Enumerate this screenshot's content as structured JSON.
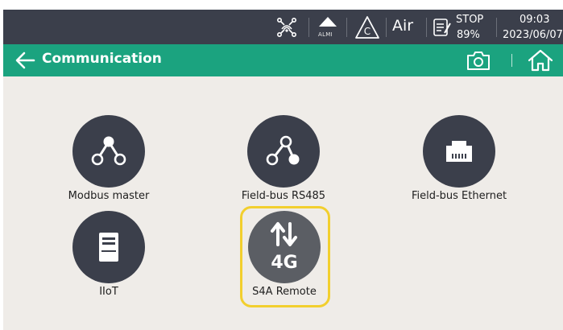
{
  "status_bar": {
    "almi_label": "ALMI",
    "air_label": "Air",
    "stop_label": "STOP",
    "percent": "89%",
    "time": "09:03",
    "date": "2023/06/07"
  },
  "title_bar": {
    "title": "Communication"
  },
  "tiles": [
    {
      "label": "Modbus master"
    },
    {
      "label": "Field-bus RS485"
    },
    {
      "label": "Field-bus Ethernet"
    },
    {
      "label": "IIoT"
    },
    {
      "label": "S4A Remote",
      "icon_text": "4G",
      "highlighted": true
    }
  ],
  "colors": {
    "status_bar_bg": "#3b3f4b",
    "title_bar_bg": "#1ba37f",
    "content_bg": "#efece8",
    "icon_circle": "#3b3f4b",
    "highlight": "#f2cf2e",
    "s4a_circle": "#5b5e64"
  },
  "icons": [
    "network-alert-icon",
    "alarm-triangle-icon",
    "c-warning-icon",
    "checklist-icon",
    "back-arrow-icon",
    "camera-icon",
    "home-icon",
    "node-graph-icon",
    "ethernet-port-icon",
    "server-tower-icon",
    "updown-arrows-icon"
  ]
}
